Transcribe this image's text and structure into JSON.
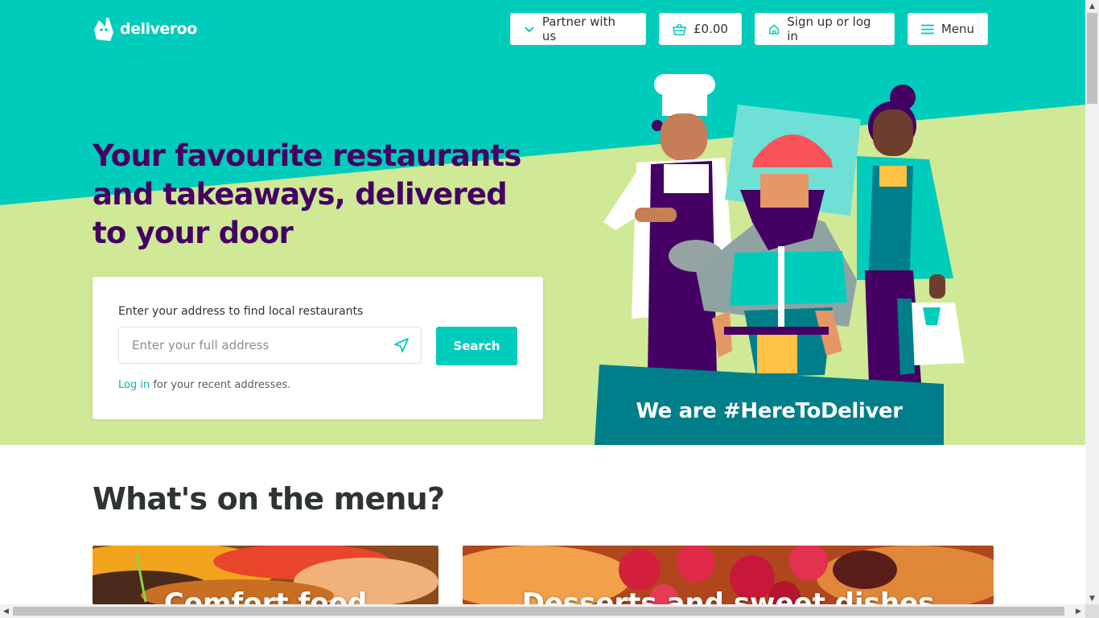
{
  "header": {
    "brand": "deliveroo",
    "nav": {
      "partner_label": "Partner with us",
      "basket_label": "£0.00",
      "signin_label": "Sign up or log in",
      "menu_label": "Menu"
    }
  },
  "hero": {
    "title": "Your favourite restaurants and takeaways, delivered to your door",
    "search": {
      "label": "Enter your address to find local restaurants",
      "placeholder": "Enter your full address",
      "button_label": "Search",
      "login_link": "Log in",
      "login_suffix": " for your recent addresses."
    },
    "banner": "We are #HereToDeliver"
  },
  "menu_section": {
    "heading": "What's on the menu?",
    "cards": [
      {
        "label": "Comfort food"
      },
      {
        "label": "Desserts and sweet dishes"
      }
    ]
  },
  "colors": {
    "teal": "#00ccbc",
    "lime": "#cfe996",
    "purple": "#440063",
    "dark_teal": "#007e8a"
  },
  "icons": [
    "deliveroo-logo-icon",
    "chevron-down-icon",
    "basket-icon",
    "home-icon",
    "hamburger-icon",
    "locate-arrow-icon"
  ]
}
